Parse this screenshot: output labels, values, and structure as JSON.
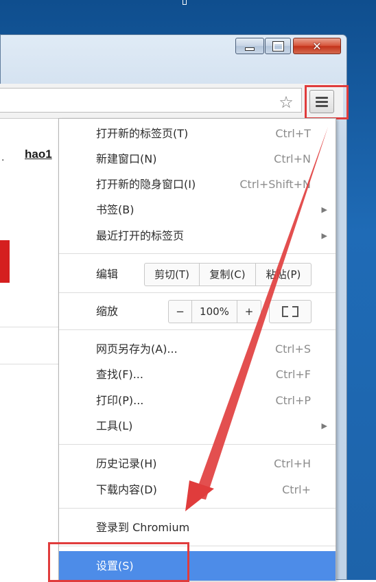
{
  "window": {
    "controls": {
      "minimize": "minimize",
      "maximize": "maximize",
      "close": "✕"
    },
    "colors": {
      "frame": "#c7d8ea",
      "close": "#c3321a",
      "desktop": "#1d63aa"
    }
  },
  "toolbar": {
    "bookmark_icon": "star-icon",
    "menu_icon": "hamburger-menu-icon"
  },
  "page": {
    "link_text": "hao1",
    "accent_color": "#d51f1f"
  },
  "menu": {
    "group1": [
      {
        "label": "打开新的标签页(T)",
        "shortcut": "Ctrl+T"
      },
      {
        "label": "新建窗口(N)",
        "shortcut": "Ctrl+N"
      },
      {
        "label": "打开新的隐身窗口(I)",
        "shortcut": "Ctrl+Shift+N"
      },
      {
        "label": "书签(B)",
        "submenu": "▶"
      },
      {
        "label": "最近打开的标签页",
        "submenu": "▶"
      }
    ],
    "edit": {
      "label": "编辑",
      "cut": "剪切(T)",
      "copy": "复制(C)",
      "paste": "粘贴(P)"
    },
    "zoom": {
      "label": "缩放",
      "minus": "−",
      "level": "100%",
      "plus": "+"
    },
    "group2": [
      {
        "label": "网页另存为(A)...",
        "shortcut": "Ctrl+S"
      },
      {
        "label": "查找(F)...",
        "shortcut": "Ctrl+F"
      },
      {
        "label": "打印(P)...",
        "shortcut": "Ctrl+P"
      },
      {
        "label": "工具(L)",
        "submenu": "▶"
      }
    ],
    "group3": [
      {
        "label": "历史记录(H)",
        "shortcut": "Ctrl+H"
      },
      {
        "label": "下载内容(D)",
        "shortcut": "Ctrl+"
      }
    ],
    "signin": "登录到 Chromium",
    "settings": "设置(S)",
    "selected_color": "#4d8ce8"
  },
  "annotation": {
    "color": "#e03c3c"
  }
}
